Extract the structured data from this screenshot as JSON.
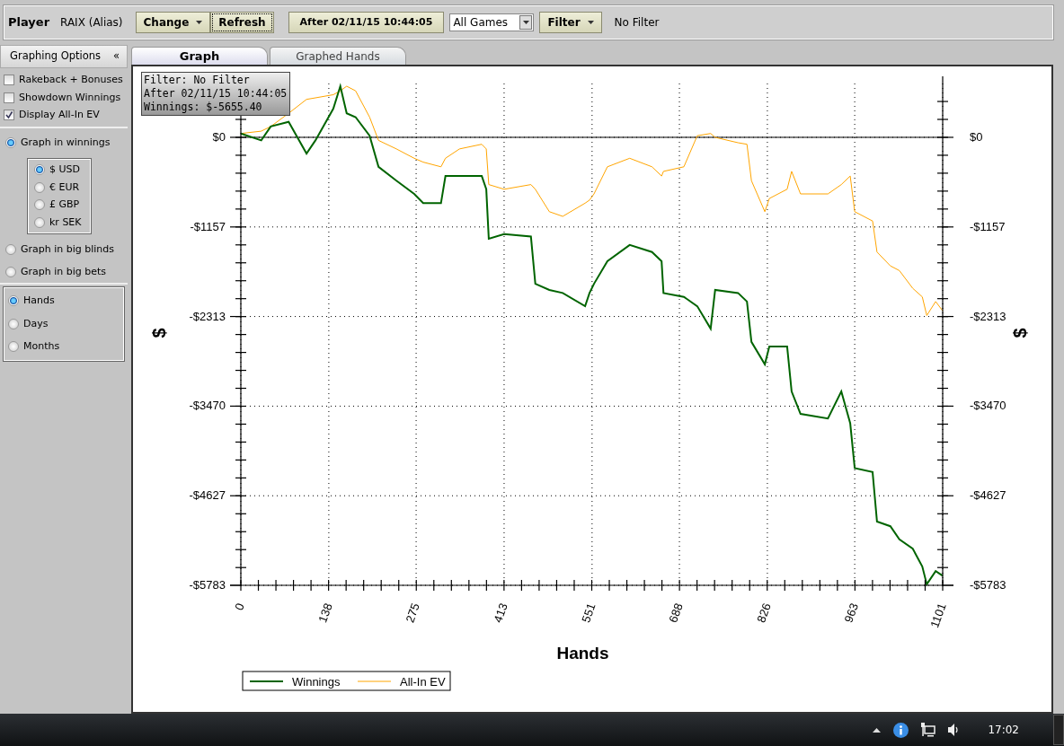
{
  "toolbar": {
    "player_label": "Player",
    "player_value": "RAIX (Alias)",
    "buttons": [
      {
        "label": "Change",
        "dropdown": true,
        "focused": false
      },
      {
        "label": "Refresh",
        "dropdown": false,
        "focused": true
      },
      {
        "label": "After 02/11/15 10:44:05",
        "dropdown": false,
        "focused": false
      }
    ],
    "game_select": {
      "value": "All Games"
    },
    "filter_button": {
      "label": "Filter",
      "dropdown": true
    },
    "filter_text": "No Filter"
  },
  "sidebar": {
    "header": "Graphing Options",
    "collapse": "«",
    "checkboxes": [
      {
        "label": "Rakeback + Bonuses",
        "checked": false
      },
      {
        "label": "Showdown Winnings",
        "checked": false
      },
      {
        "label": "Display All-In EV",
        "checked": true
      }
    ],
    "graph_units": [
      {
        "label": "Graph in winnings",
        "selected": true,
        "children": [
          {
            "label": "$ USD",
            "selected": true
          },
          {
            "label": "€ EUR",
            "selected": false
          },
          {
            "label": "£ GBP",
            "selected": false
          },
          {
            "label": "kr SEK",
            "selected": false
          }
        ]
      },
      {
        "label": "Graph in big blinds",
        "selected": false
      },
      {
        "label": "Graph in big bets",
        "selected": false
      }
    ],
    "x_axis": [
      {
        "label": "Hands",
        "selected": true
      },
      {
        "label": "Days",
        "selected": false
      },
      {
        "label": "Months",
        "selected": false
      }
    ]
  },
  "tabs": [
    {
      "label": "Graph",
      "selected": true
    },
    {
      "label": "Graphed Hands",
      "selected": false
    }
  ],
  "tooltip": [
    "Filter: No Filter",
    "After 02/11/15 10:44:05",
    "Winnings: $-5655.40"
  ],
  "chart_data": {
    "type": "line",
    "xlabel": "Hands",
    "ylabel": "$",
    "xlim": [
      0,
      1101
    ],
    "ylim": [
      -5783,
      695
    ],
    "grid": true,
    "legend": true,
    "xticks": [
      0,
      138,
      275,
      413,
      551,
      688,
      826,
      963,
      1101
    ],
    "yticks": [
      {
        "value": 0,
        "label": "$0"
      },
      {
        "value": -1157,
        "label": "-$1157"
      },
      {
        "value": -2313,
        "label": "-$2313"
      },
      {
        "value": -3470,
        "label": "-$3470"
      },
      {
        "value": -4627,
        "label": "-$4627"
      },
      {
        "value": -5783,
        "label": "-$5783"
      }
    ],
    "x": [
      0,
      32,
      47,
      75,
      103,
      117,
      145,
      156,
      166,
      180,
      202,
      216,
      244,
      272,
      286,
      314,
      321,
      343,
      378,
      385,
      389,
      413,
      455,
      462,
      484,
      505,
      540,
      547,
      554,
      575,
      610,
      645,
      660,
      663,
      695,
      716,
      737,
      744,
      780,
      794,
      801,
      822,
      829,
      857,
      864,
      878,
      921,
      942,
      956,
      963,
      991,
      998,
      1019,
      1033,
      1054,
      1069,
      1076,
      1090,
      1101
    ],
    "series": [
      {
        "name": "Winnings",
        "color": "#006400",
        "values": [
          50,
          -40,
          140,
          200,
          -210,
          -40,
          370,
          660,
          310,
          260,
          20,
          -380,
          -560,
          -730,
          -850,
          -850,
          -500,
          -500,
          -500,
          -670,
          -1310,
          -1250,
          -1280,
          -1890,
          -1970,
          -2010,
          -2180,
          -2010,
          -1890,
          -1600,
          -1390,
          -1480,
          -1600,
          -2010,
          -2060,
          -2180,
          -2470,
          -1970,
          -2010,
          -2120,
          -2640,
          -2930,
          -2700,
          -2700,
          -3280,
          -3570,
          -3630,
          -3280,
          -3690,
          -4270,
          -4320,
          -4960,
          -5020,
          -5190,
          -5310,
          -5540,
          -5770,
          -5600,
          -5660
        ]
      },
      {
        "name": "All-In EV",
        "color": "#ffa500",
        "values": [
          50,
          80,
          140,
          310,
          490,
          510,
          550,
          600,
          660,
          600,
          260,
          -40,
          -150,
          -270,
          -320,
          -380,
          -270,
          -150,
          -90,
          -150,
          -610,
          -670,
          -610,
          -670,
          -960,
          -1020,
          -850,
          -810,
          -730,
          -380,
          -270,
          -380,
          -500,
          -440,
          -380,
          20,
          50,
          0,
          -70,
          -90,
          -560,
          -960,
          -790,
          -670,
          -440,
          -730,
          -730,
          -610,
          -500,
          -960,
          -1080,
          -1480,
          -1660,
          -1720,
          -1950,
          -2060,
          -2300,
          -2120,
          -2240
        ]
      }
    ]
  },
  "right_axis": {
    "title": "$",
    "labels": [
      "$0",
      "-$1157",
      "-$2313",
      "-$3470",
      "-$4627",
      "-$5783"
    ]
  },
  "taskbar": {
    "clock": "17:02"
  }
}
